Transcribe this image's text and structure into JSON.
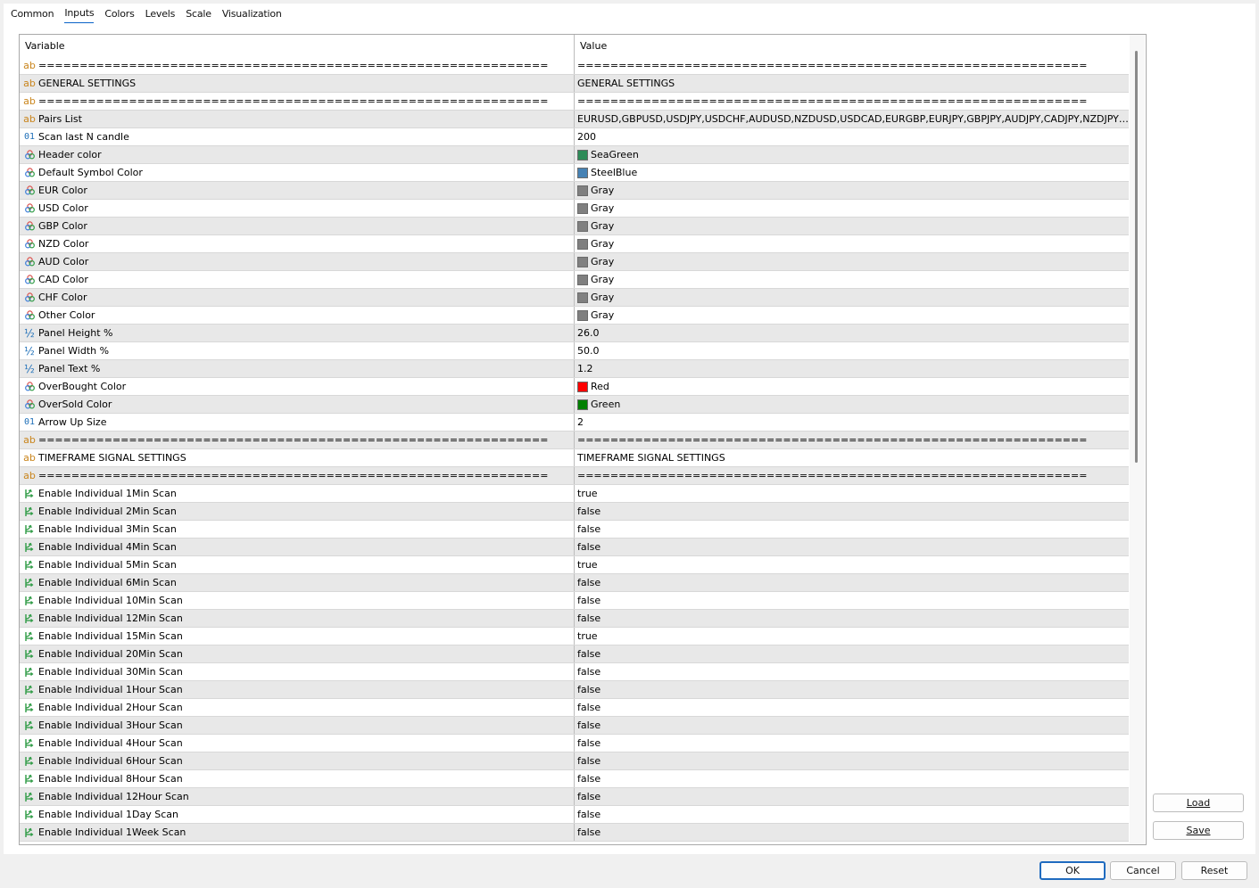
{
  "tabs": [
    {
      "label": "Common",
      "active": false
    },
    {
      "label": "Inputs",
      "active": true
    },
    {
      "label": "Colors",
      "active": false
    },
    {
      "label": "Levels",
      "active": false
    },
    {
      "label": "Scale",
      "active": false
    },
    {
      "label": "Visualization",
      "active": false
    }
  ],
  "grid": {
    "columns": {
      "variable": "Variable",
      "value": "Value"
    },
    "rows": [
      {
        "icon": "string-icon",
        "variable": "==============================================================",
        "value": "==============================================================",
        "swatch": ""
      },
      {
        "icon": "string-icon",
        "variable": "GENERAL  SETTINGS",
        "value": "GENERAL SETTINGS",
        "swatch": ""
      },
      {
        "icon": "string-icon",
        "variable": "==============================================================",
        "value": "==============================================================",
        "swatch": ""
      },
      {
        "icon": "string-icon",
        "variable": "Pairs List",
        "value": "EURUSD,GBPUSD,USDJPY,USDCHF,AUDUSD,NZDUSD,USDCAD,EURGBP,EURJPY,GBPJPY,AUDJPY,CADJPY,NZDJPY,CHFJPY,E...",
        "swatch": ""
      },
      {
        "icon": "integer-icon",
        "variable": "Scan last N candle",
        "value": "200",
        "swatch": ""
      },
      {
        "icon": "color-icon",
        "variable": "Header color",
        "value": "SeaGreen",
        "swatch": "#2e8b57"
      },
      {
        "icon": "color-icon",
        "variable": "Default Symbol Color",
        "value": "SteelBlue",
        "swatch": "#4682b4"
      },
      {
        "icon": "color-icon",
        "variable": "EUR Color",
        "value": "Gray",
        "swatch": "#808080"
      },
      {
        "icon": "color-icon",
        "variable": "USD Color",
        "value": "Gray",
        "swatch": "#808080"
      },
      {
        "icon": "color-icon",
        "variable": "GBP Color",
        "value": "Gray",
        "swatch": "#808080"
      },
      {
        "icon": "color-icon",
        "variable": "NZD Color",
        "value": "Gray",
        "swatch": "#808080"
      },
      {
        "icon": "color-icon",
        "variable": "AUD Color",
        "value": "Gray",
        "swatch": "#808080"
      },
      {
        "icon": "color-icon",
        "variable": "CAD Color",
        "value": "Gray",
        "swatch": "#808080"
      },
      {
        "icon": "color-icon",
        "variable": "CHF Color",
        "value": "Gray",
        "swatch": "#808080"
      },
      {
        "icon": "color-icon",
        "variable": "Other Color",
        "value": "Gray",
        "swatch": "#808080"
      },
      {
        "icon": "double-icon",
        "variable": "Panel Height %",
        "value": "26.0",
        "swatch": ""
      },
      {
        "icon": "double-icon",
        "variable": "Panel Width %",
        "value": "50.0",
        "swatch": ""
      },
      {
        "icon": "double-icon",
        "variable": "Panel Text %",
        "value": "1.2",
        "swatch": ""
      },
      {
        "icon": "color-icon",
        "variable": "OverBought Color",
        "value": "Red",
        "swatch": "#ff0000"
      },
      {
        "icon": "color-icon",
        "variable": "OverSold Color",
        "value": "Green",
        "swatch": "#008000"
      },
      {
        "icon": "integer-icon",
        "variable": "Arrow Up Size",
        "value": "2",
        "swatch": ""
      },
      {
        "icon": "string-icon",
        "variable": "==============================================================",
        "value": "==============================================================",
        "swatch": ""
      },
      {
        "icon": "string-icon",
        "variable": "TIMEFRAME SIGNAL SETTINGS",
        "value": "TIMEFRAME SIGNAL SETTINGS",
        "swatch": ""
      },
      {
        "icon": "string-icon",
        "variable": "==============================================================",
        "value": "==============================================================",
        "swatch": ""
      },
      {
        "icon": "bool-icon",
        "variable": "Enable Individual 1Min Scan",
        "value": "true",
        "swatch": ""
      },
      {
        "icon": "bool-icon",
        "variable": "Enable Individual 2Min Scan",
        "value": "false",
        "swatch": ""
      },
      {
        "icon": "bool-icon",
        "variable": "Enable Individual 3Min Scan",
        "value": "false",
        "swatch": ""
      },
      {
        "icon": "bool-icon",
        "variable": "Enable Individual 4Min Scan",
        "value": "false",
        "swatch": ""
      },
      {
        "icon": "bool-icon",
        "variable": "Enable Individual 5Min Scan",
        "value": "true",
        "swatch": ""
      },
      {
        "icon": "bool-icon",
        "variable": "Enable Individual 6Min Scan",
        "value": "false",
        "swatch": ""
      },
      {
        "icon": "bool-icon",
        "variable": "Enable Individual 10Min Scan",
        "value": "false",
        "swatch": ""
      },
      {
        "icon": "bool-icon",
        "variable": "Enable Individual 12Min Scan",
        "value": "false",
        "swatch": ""
      },
      {
        "icon": "bool-icon",
        "variable": "Enable Individual 15Min Scan",
        "value": "true",
        "swatch": ""
      },
      {
        "icon": "bool-icon",
        "variable": "Enable Individual 20Min Scan",
        "value": "false",
        "swatch": ""
      },
      {
        "icon": "bool-icon",
        "variable": "Enable Individual 30Min Scan",
        "value": "false",
        "swatch": ""
      },
      {
        "icon": "bool-icon",
        "variable": "Enable Individual 1Hour Scan",
        "value": "false",
        "swatch": ""
      },
      {
        "icon": "bool-icon",
        "variable": "Enable Individual 2Hour Scan",
        "value": "false",
        "swatch": ""
      },
      {
        "icon": "bool-icon",
        "variable": "Enable Individual 3Hour Scan",
        "value": "false",
        "swatch": ""
      },
      {
        "icon": "bool-icon",
        "variable": "Enable Individual 4Hour Scan",
        "value": "false",
        "swatch": ""
      },
      {
        "icon": "bool-icon",
        "variable": "Enable Individual 6Hour Scan",
        "value": "false",
        "swatch": ""
      },
      {
        "icon": "bool-icon",
        "variable": "Enable Individual 8Hour Scan",
        "value": "false",
        "swatch": ""
      },
      {
        "icon": "bool-icon",
        "variable": "Enable Individual 12Hour Scan",
        "value": "false",
        "swatch": ""
      },
      {
        "icon": "bool-icon",
        "variable": "Enable Individual 1Day Scan",
        "value": "false",
        "swatch": ""
      },
      {
        "icon": "bool-icon",
        "variable": "Enable Individual 1Week Scan",
        "value": "false",
        "swatch": ""
      }
    ]
  },
  "side_buttons": {
    "load": "Load",
    "save": "Save"
  },
  "bottom_buttons": {
    "ok": "OK",
    "cancel": "Cancel",
    "reset": "Reset"
  }
}
